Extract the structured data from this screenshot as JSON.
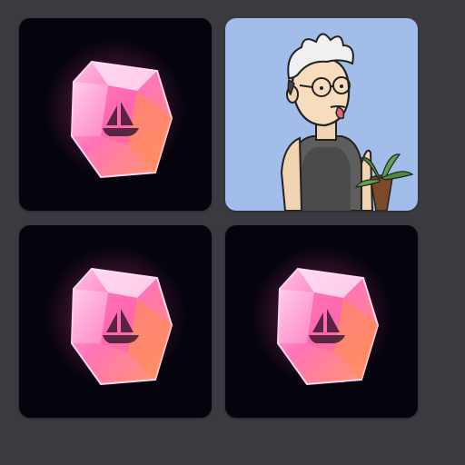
{
  "grid": {
    "tiles": [
      {
        "kind": "gem",
        "icon": "opensea-gem-icon"
      },
      {
        "kind": "character",
        "icon": "character-portrait-icon"
      },
      {
        "kind": "gem",
        "icon": "opensea-gem-icon"
      },
      {
        "kind": "gem",
        "icon": "opensea-gem-icon"
      }
    ]
  },
  "colors": {
    "page_background": "#3a3a40",
    "tile_dark": "#05030c",
    "tile_light": "#a3bdeb",
    "gem_pink": "#ff6fb6",
    "gem_orange": "#ff9a63"
  }
}
